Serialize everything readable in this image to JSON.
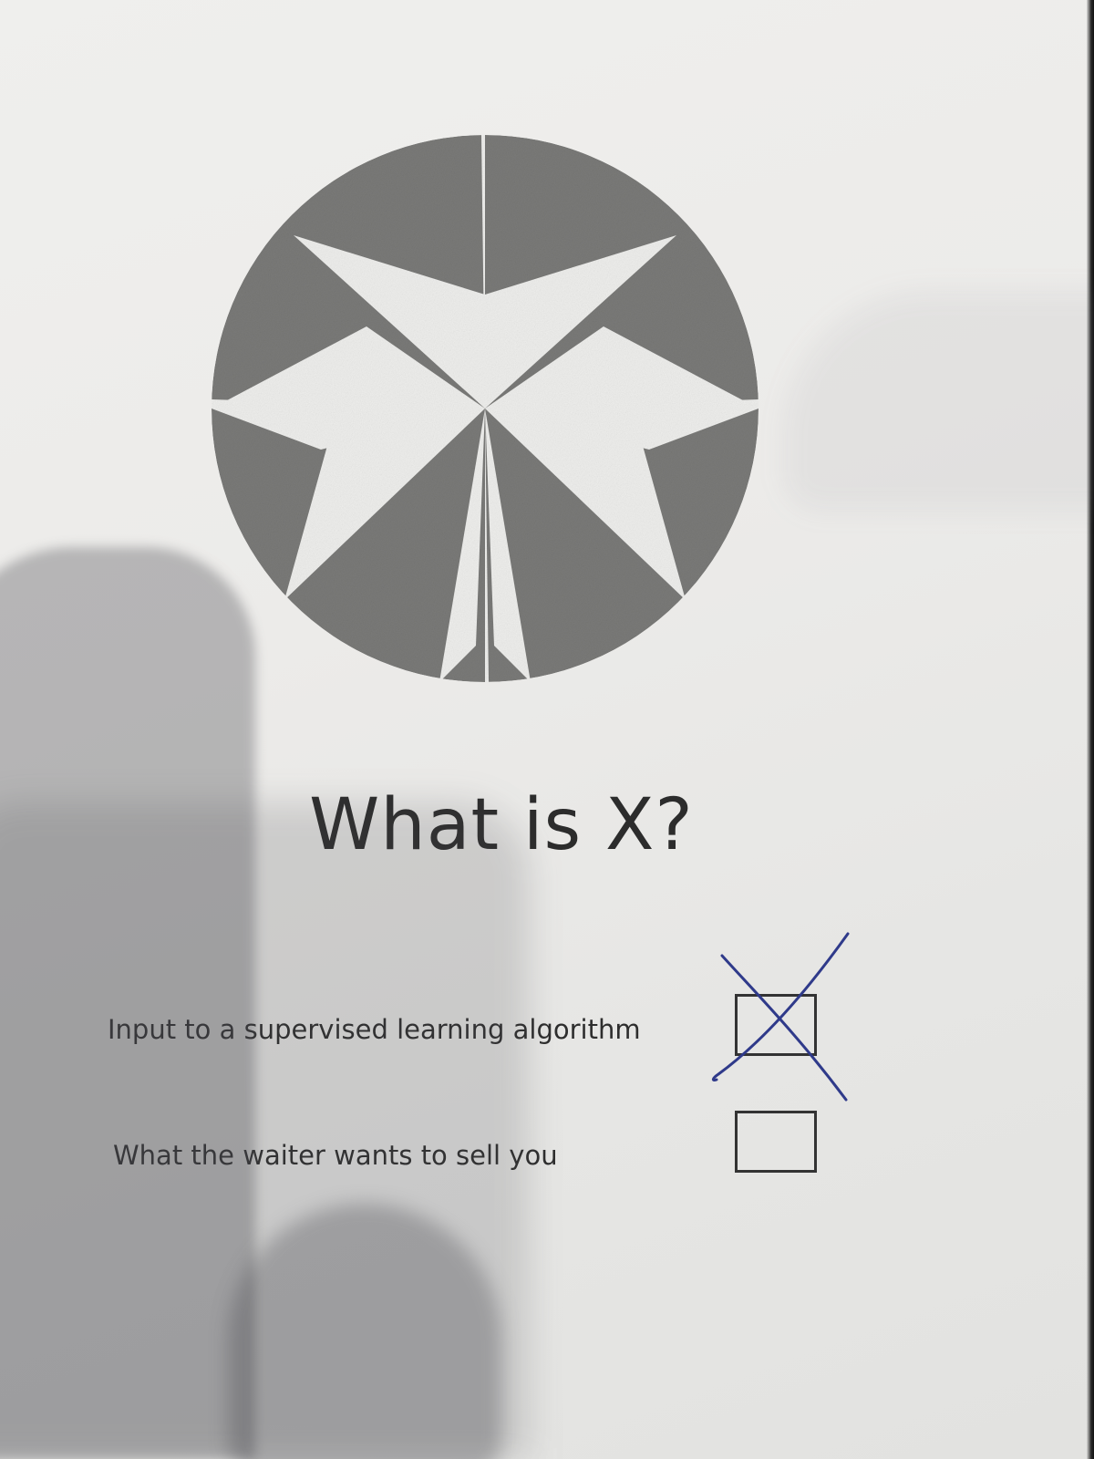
{
  "title": "What is X?",
  "options": [
    {
      "label": "Input to a supervised learning algorithm",
      "checked": true
    },
    {
      "label": "What the waiter wants to sell you",
      "checked": false
    }
  ],
  "colors": {
    "logo": "#7a7a78",
    "ink_mark": "#2f3a8a",
    "text": "#2c2c2c"
  },
  "icons": {
    "logo": "pinwheel-logo-icon",
    "mark": "hand-drawn-x-mark-icon"
  }
}
